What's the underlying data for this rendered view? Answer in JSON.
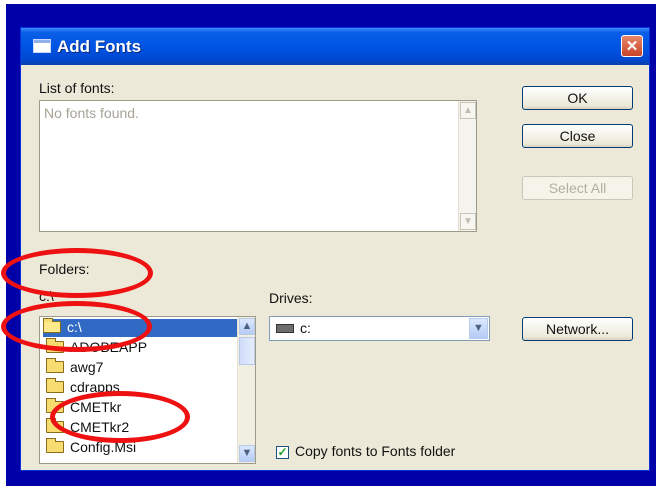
{
  "dialog": {
    "title": "Add Fonts",
    "close_glyph": "✕"
  },
  "list_of_fonts": {
    "label": "List of fonts:",
    "empty_text": "No fonts found."
  },
  "buttons": {
    "ok": "OK",
    "close": "Close",
    "select_all": "Select All",
    "network": "Network..."
  },
  "folders": {
    "label": "Folders:",
    "path": "c:\\",
    "items": [
      "c:\\",
      "ADOBEAPP",
      "awg7",
      "cdrapps",
      "CMETkr",
      "CMETkr2",
      "Config.Msi"
    ]
  },
  "drives": {
    "label": "Drives:",
    "selected": "c:"
  },
  "copy_fonts": {
    "label": "Copy fonts to Fonts folder",
    "checked": true
  },
  "icons": {
    "title": "window-icon",
    "drive": "hard-drive-icon",
    "folder": "folder-icon"
  },
  "colors": {
    "titlebar": "#0054e3",
    "dialog_bg": "#ece9d8",
    "selection": "#316ac5",
    "annotation": "#ee1111",
    "frame": "#0000a8"
  }
}
